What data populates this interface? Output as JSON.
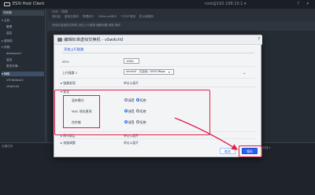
{
  "app": {
    "title": "ESXi Host Client",
    "host_label": "root@192.168.10.1 ▾",
    "window_controls": "? ▾"
  },
  "sidebar": {
    "header": "导航器",
    "items": [
      {
        "label": "▾ 主机",
        "selected": false
      },
      {
        "label": "管理",
        "selected": false
      },
      {
        "label": "监控",
        "selected": false
      },
      {
        "label": "▸ 虚拟机",
        "selected": false
      },
      {
        "label": "▾ 存储",
        "selected": false
      },
      {
        "label": "datastore1",
        "selected": false
      },
      {
        "label": "监控",
        "selected": false
      },
      {
        "label": "更多存储...",
        "selected": false
      },
      {
        "label": "▾ 网络",
        "selected": true
      },
      {
        "label": "VM Network",
        "selected": false
      },
      {
        "label": "vSwitch0",
        "selected": false
      }
    ]
  },
  "main": {
    "breadcrumb": "esxi - 网络",
    "tabs": "端口组  虚拟交换机  物理网卡  VMkernel网卡  TCP/IP堆栈  防火墙规则",
    "toolbar": "添加标准虚拟交换机  添加上行链路  编辑设置  刷新  操作",
    "recent_tasks": "近期任务",
    "right_status": "已完成 ▾"
  },
  "dialog": {
    "title": "编辑标准虚拟交换机 - vSwitch0",
    "help": "?",
    "section_link": "添加上行链路",
    "rows": {
      "mtu_label": "MTU",
      "mtu_value": "1500",
      "uplink_label": "上行链路 1",
      "uplink_value": "vmnic0 - 已启动, 1000 Mbps",
      "link_discovery_label": "▸ 链路发现",
      "link_discovery_value": "单击以展开",
      "security_label": "▾ 安全",
      "promiscuous_label": "混杂模式",
      "mac_changes_label": "MAC 地址更改",
      "forged_label": "伪传输",
      "accept": "接受",
      "reject": "拒绝",
      "nic_teaming_label": "▸ 网卡绑定",
      "nic_teaming_value": "单击以展开",
      "traffic_label": "▸ 流量调整",
      "traffic_value": "单击以展开"
    },
    "buttons": {
      "cancel": "取消",
      "save": "保存"
    }
  },
  "colors": {
    "highlight": "#e11d48",
    "accent": "#2563eb"
  }
}
